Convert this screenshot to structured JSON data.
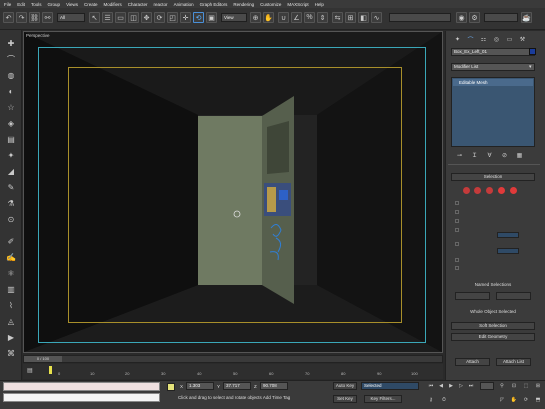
{
  "menu": [
    "File",
    "Edit",
    "Tools",
    "Group",
    "Views",
    "Create",
    "Modifiers",
    "Character",
    "reactor",
    "Animation",
    "Graph Editors",
    "Rendering",
    "Customize",
    "MAXScript",
    "Help"
  ],
  "toolbar": {
    "selection_filter": "All",
    "ref_coord": "View"
  },
  "viewport": {
    "label": "Perspective"
  },
  "command_panel": {
    "object_name": "Box_Ex_Left_01",
    "modifier_list_label": "Modifier List",
    "stack_item": "Editable Mesh",
    "rollouts": {
      "selection": "Selection",
      "named_selections": "Named Selections",
      "whole_object": "Whole Object Selected",
      "soft_selection": "Soft Selection",
      "edit_geometry": "Edit Geometry",
      "attach": "Attach",
      "attach_list": "Attach List"
    },
    "object_color": "#1a3c9a"
  },
  "timeline": {
    "frame_readout": "0 / 100",
    "ticks": [
      "0",
      "10",
      "20",
      "30",
      "40",
      "50",
      "60",
      "70",
      "80",
      "90",
      "100"
    ]
  },
  "status": {
    "x_value": "1.303",
    "y_value": "37.717",
    "z_value": "90.708",
    "prompt": "Click and drag to select and rotate objects",
    "add_time_tag": "Add Time Tag",
    "auto_key": "Auto Key",
    "set_key": "Set Key",
    "selected_label": "Selected",
    "key_filters": "Key Filters...",
    "x_label": "X",
    "y_label": "Y",
    "z_label": "Z"
  }
}
